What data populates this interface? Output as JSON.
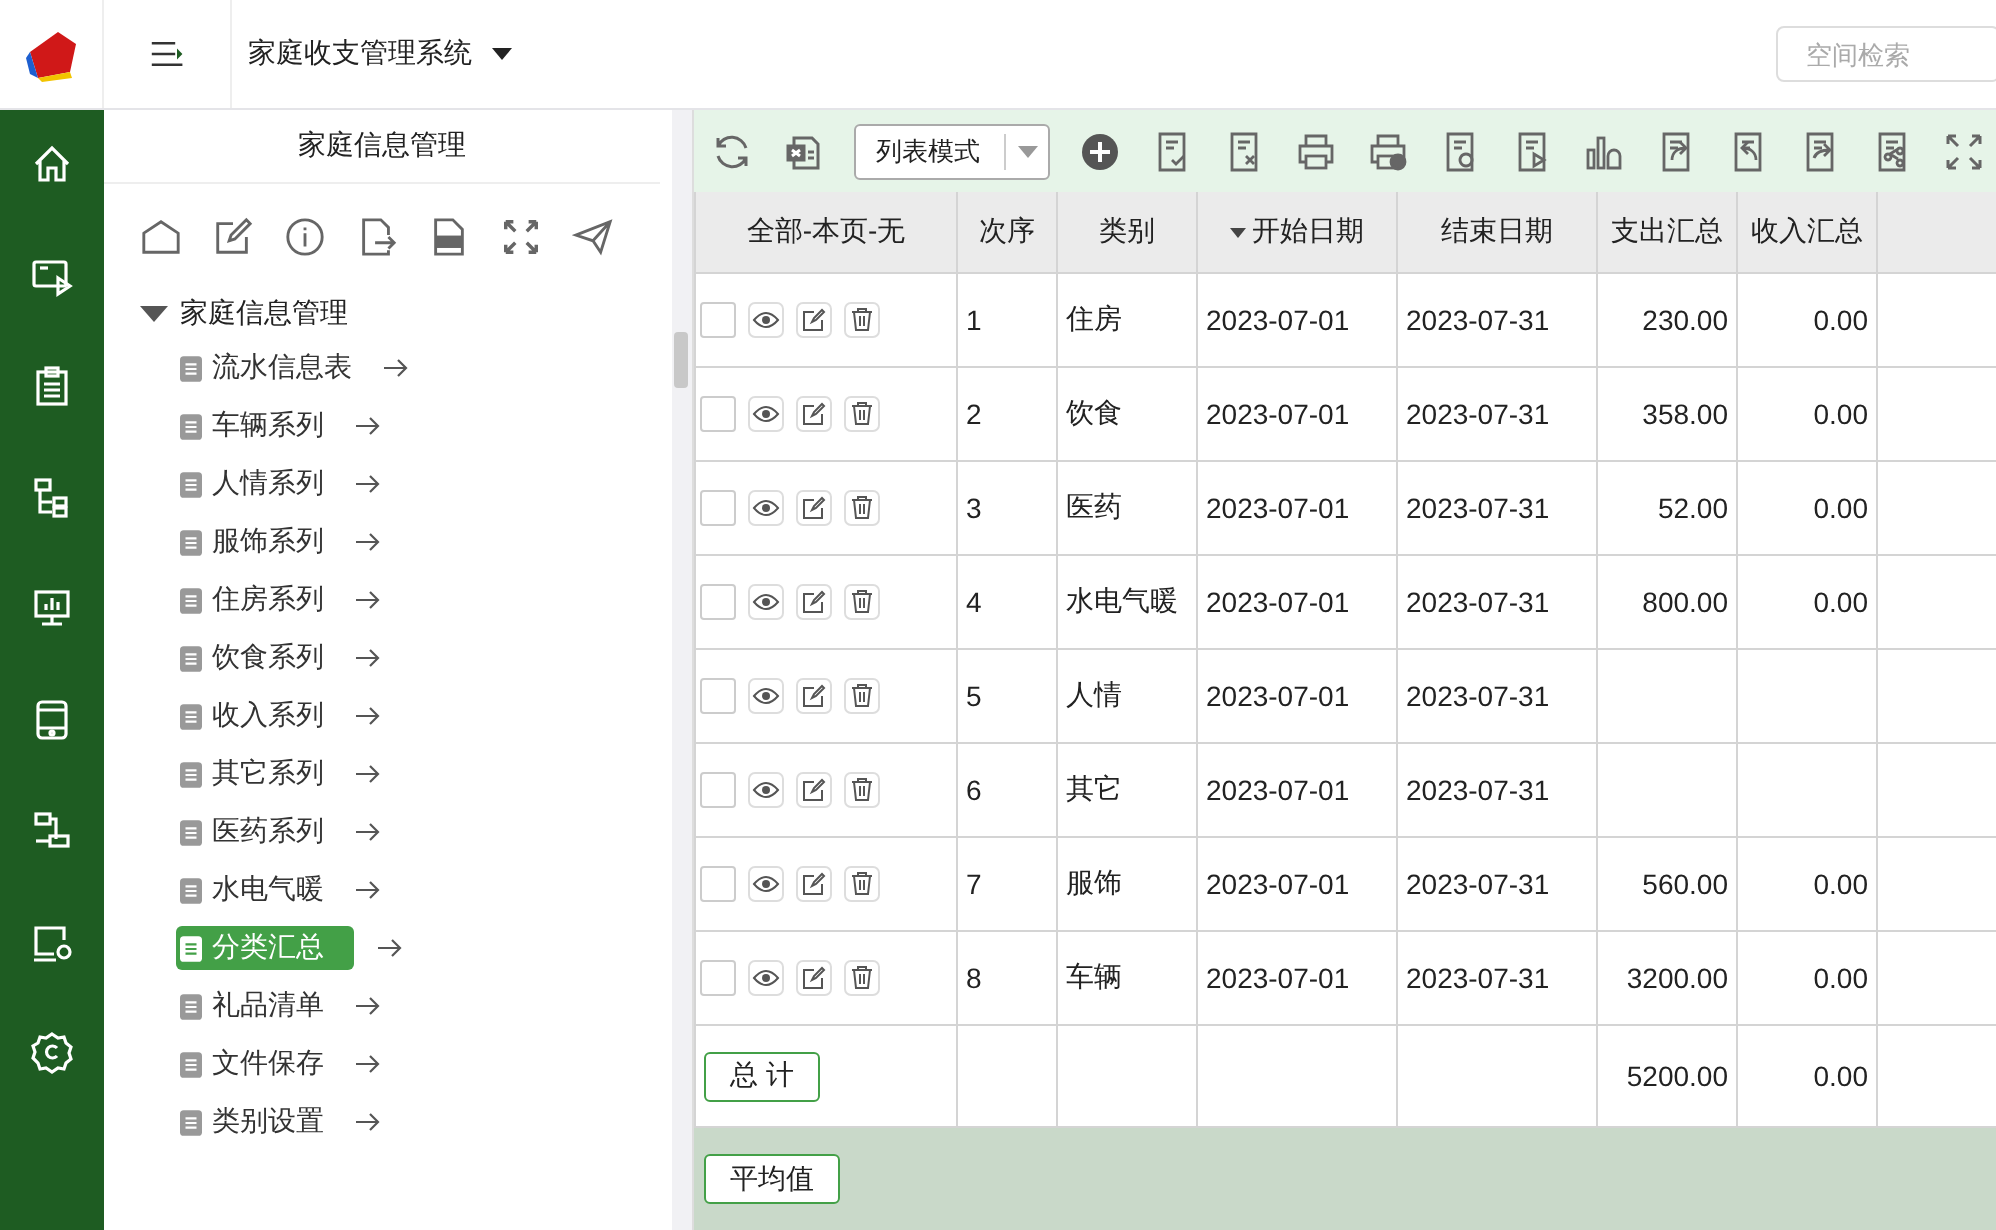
{
  "header": {
    "app_title": "家庭收支管理系统",
    "search": {
      "placeholder": "空间检索"
    }
  },
  "tree_panel": {
    "title": "家庭信息管理",
    "root": {
      "label": "家庭信息管理",
      "expanded": true,
      "children": [
        {
          "label": "流水信息表",
          "selected": false
        },
        {
          "label": "车辆系列",
          "selected": false
        },
        {
          "label": "人情系列",
          "selected": false
        },
        {
          "label": "服饰系列",
          "selected": false
        },
        {
          "label": "住房系列",
          "selected": false
        },
        {
          "label": "饮食系列",
          "selected": false
        },
        {
          "label": "收入系列",
          "selected": false
        },
        {
          "label": "其它系列",
          "selected": false
        },
        {
          "label": "医药系列",
          "selected": false
        },
        {
          "label": "水电气暖",
          "selected": false
        },
        {
          "label": "分类汇总",
          "selected": true
        },
        {
          "label": "礼品清单",
          "selected": false
        },
        {
          "label": "文件保存",
          "selected": false
        },
        {
          "label": "类别设置",
          "selected": false
        }
      ]
    }
  },
  "toolbar": {
    "view_mode": "列表模式"
  },
  "table": {
    "columns": [
      {
        "label": "全部-本页-无",
        "sorted": false
      },
      {
        "label": "次序",
        "sorted": false
      },
      {
        "label": "类别",
        "sorted": false
      },
      {
        "label": "开始日期",
        "sorted": true
      },
      {
        "label": "结束日期",
        "sorted": false
      },
      {
        "label": "支出汇总",
        "sorted": false
      },
      {
        "label": "收入汇总",
        "sorted": false
      }
    ],
    "rows": [
      {
        "checked": false,
        "seq": "1",
        "category": "住房",
        "start": "2023-07-01",
        "end": "2023-07-31",
        "expense": "230.00",
        "income": "0.00"
      },
      {
        "checked": false,
        "seq": "2",
        "category": "饮食",
        "start": "2023-07-01",
        "end": "2023-07-31",
        "expense": "358.00",
        "income": "0.00"
      },
      {
        "checked": false,
        "seq": "3",
        "category": "医药",
        "start": "2023-07-01",
        "end": "2023-07-31",
        "expense": "52.00",
        "income": "0.00"
      },
      {
        "checked": false,
        "seq": "4",
        "category": "水电气暖",
        "start": "2023-07-01",
        "end": "2023-07-31",
        "expense": "800.00",
        "income": "0.00"
      },
      {
        "checked": false,
        "seq": "5",
        "category": "人情",
        "start": "2023-07-01",
        "end": "2023-07-31"
      },
      {
        "checked": false,
        "seq": "6",
        "category": "其它",
        "start": "2023-07-01",
        "end": "2023-07-31"
      },
      {
        "checked": false,
        "seq": "7",
        "category": "服饰",
        "start": "2023-07-01",
        "end": "2023-07-31",
        "expense": "560.00",
        "income": "0.00"
      },
      {
        "checked": false,
        "seq": "8",
        "category": "车辆",
        "start": "2023-07-01",
        "end": "2023-07-31",
        "expense": "3200.00",
        "income": "0.00"
      }
    ],
    "total": {
      "label": "总 计",
      "expense": "5200.00",
      "income": "0.00"
    },
    "average": {
      "label": "平均值"
    }
  }
}
